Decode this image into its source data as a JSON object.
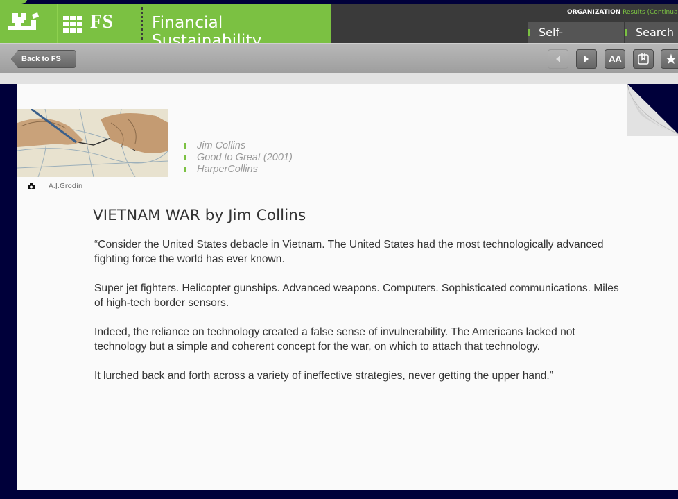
{
  "header": {
    "logo_icon": "building-logo-icon",
    "app_short": "FS",
    "app_title": "Financial Sustainability",
    "org_label": "ORGANIZATION",
    "org_results": "Results (Continua",
    "tabs": [
      {
        "label": "Self-Assessment"
      },
      {
        "label": "Search"
      }
    ]
  },
  "toolbar": {
    "back_label": "Back to FS",
    "font_label": "AA",
    "buttons": [
      "prev-arrow-icon",
      "next-arrow-icon",
      "font-size-icon",
      "bookmark-icon",
      "star-icon"
    ]
  },
  "article": {
    "photo_credit": "A.J.Grodin",
    "meta": [
      "Jim Collins",
      "Good to Great (2001)",
      "HarperCollins"
    ],
    "title": "VIETNAM WAR by Jim Collins",
    "paragraphs": [
      "“Consider the United States debacle in Vietnam.  The United States had the most technologically advanced fighting force the world has ever known.",
      "Super jet fighters.  Helicopter gunships.  Advanced weapons.  Computers.  Sophisticated communications.  Miles of high-tech border sensors.",
      "Indeed, the reliance on technology created a false sense of invulnerability.  The Americans lacked not technology but a simple and coherent concept for the war, on which to attach that technology.",
      "It lurched back and forth across a variety of ineffective strategies, never getting the upper hand.”"
    ]
  },
  "colors": {
    "accent": "#7bc142",
    "header_bg": "#3a3a3a",
    "page_bg": "#00003a"
  }
}
